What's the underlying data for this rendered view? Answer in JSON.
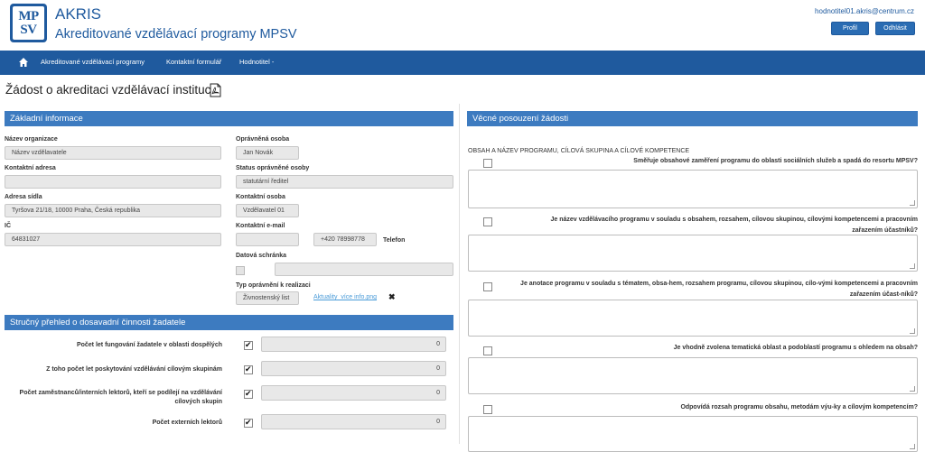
{
  "header": {
    "logo_letters": [
      "MP",
      "SV"
    ],
    "brand": "AKRIS",
    "subtitle": "Akreditované vzdělávací programy MPSV",
    "user_email": "hodnotitel01.akris@centrum.cz",
    "profile_label": "Profil",
    "logout_label": "Odhlásit"
  },
  "nav": {
    "home_icon": "home-icon",
    "items": [
      "Akreditované vzdělávací programy",
      "Kontaktní formulář",
      "Hodnotitel -"
    ]
  },
  "page": {
    "title": "Žádost o akreditaci vzdělávací instituce",
    "pdf_icon": "pdf-icon"
  },
  "basic": {
    "heading": "Základní informace",
    "org_name_label": "Název organizace",
    "org_name_value": "Název vzdělavatele",
    "contact_address_label": "Kontaktní adresa",
    "contact_address_value": "",
    "seat_address_label": "Adresa sídla",
    "seat_address_value": "Tyršova  21/18, 10000 Praha, Česká republika",
    "ic_label": "IČ",
    "ic_value": "64831027",
    "authorized_label": "Oprávněná osoba",
    "authorized_value": "Jan Novák",
    "authorized_status_label": "Status oprávněné osoby",
    "authorized_status_value": "statutární ředitel",
    "contact_person_label": "Kontaktní osoba",
    "contact_person_value": "Vzdělavatel 01",
    "contact_email_label": "Kontaktní e-mail",
    "contact_email_value": "",
    "phone_value": "+420 78998778",
    "phone_label": "Telefon",
    "data_box_label": "Datová schránka",
    "data_box_value": "",
    "license_label": "Typ oprávnění k realizaci",
    "license_value": "Živnostenský list",
    "attachment_link": "Aktuality_více info.png"
  },
  "overview": {
    "heading": "Stručný přehled o dosavadní činnosti žadatele",
    "rows": [
      {
        "label": "Počet let fungování žadatele v oblasti dospělých",
        "value": "0"
      },
      {
        "label": "Z toho počet let poskytování vzdělávání cílovým skupinám",
        "value": "0"
      },
      {
        "label": "Počet zaměstnanců/interních lektorů, kteří se podílejí na vzdělávání cílových skupin",
        "value": "0"
      },
      {
        "label": "Počet externích lektorů",
        "value": "0"
      }
    ]
  },
  "assessment": {
    "heading": "Věcné posouzení žádosti",
    "section_caption": "OBSAH A NÁZEV PROGRAMU, CÍLOVÁ SKUPINA A CÍLOVÉ KOMPETENCE",
    "questions": [
      "Směřuje obsahové zaměření programu do oblasti sociálních služeb a spadá do resortu MPSV?",
      "Je název vzdělávacího programu v souladu s obsahem, rozsahem, cílovou skupinou, cílovými kompetencemi a pracovním zařazením účastníků?",
      "Je anotace programu v souladu s tématem, obsa-hem, rozsahem programu, cílovou skupinou, cílo-vými kompetencemi a pracovním zařazením účast-níků?",
      "Je vhodně zvolena tematická oblast a podoblastí programu s ohledem na obsah?",
      "Odpovídá rozsah programu obsahu, metodám výu-ky a cílovým kompetencím?"
    ]
  },
  "colors": {
    "brand": "#1f5a9e",
    "panel": "#3d7bc0",
    "link": "#4a9bd8"
  }
}
